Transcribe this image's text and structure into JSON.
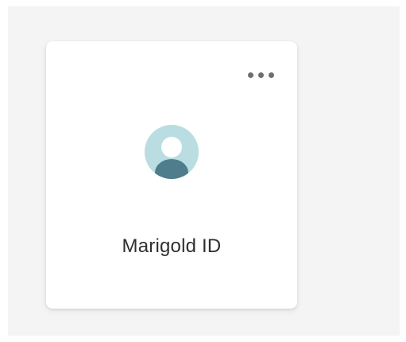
{
  "colors": {
    "page_background": "#f4f4f4",
    "card_background": "#ffffff",
    "avatar_ring": "#b9dde0",
    "avatar_person": "#4f7d8c",
    "dots": "#6e6e6e",
    "title_text": "#2f2f2f"
  },
  "card": {
    "title": "Marigold ID",
    "avatar_icon": "user-avatar-icon",
    "menu_icon": "more-horizontal-icon"
  }
}
